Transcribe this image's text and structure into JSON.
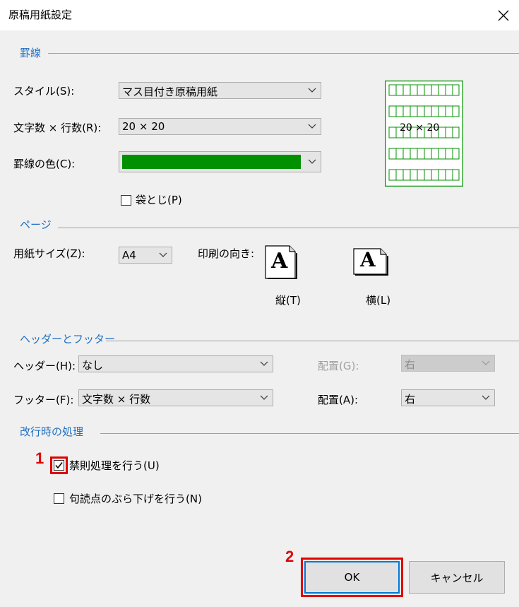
{
  "window": {
    "title": "原稿用紙設定"
  },
  "groups": {
    "keisen": "罫線",
    "page": "ページ",
    "header_footer": "ヘッダーとフッター",
    "linebreak": "改行時の処理"
  },
  "keisen": {
    "style_label": "スタイル(S):",
    "style_value": "マス目付き原稿用紙",
    "count_label": "文字数 × 行数(R):",
    "count_value": "20 × 20",
    "color_label": "罫線の色(C):",
    "color_value": "#009000",
    "fukuro_label": "袋とじ(P)",
    "fukuro_checked": false,
    "preview_text": "20 × 20"
  },
  "page": {
    "size_label": "用紙サイズ(Z):",
    "size_value": "A4",
    "orientation_label": "印刷の向き:",
    "portrait_label": "縦(T)",
    "landscape_label": "横(L)",
    "icon_letter": "A"
  },
  "header_footer": {
    "header_label": "ヘッダー(H):",
    "header_value": "なし",
    "header_align_label": "配置(G):",
    "header_align_value": "右",
    "footer_label": "フッター(F):",
    "footer_value": "文字数 × 行数",
    "footer_align_label": "配置(A):",
    "footer_align_value": "右"
  },
  "linebreak": {
    "kinsoku_label": "禁則処理を行う(U)",
    "kinsoku_checked": true,
    "kutoten_label": "句読点のぶら下げを行う(N)",
    "kutoten_checked": false
  },
  "buttons": {
    "ok": "OK",
    "cancel": "キャンセル"
  },
  "annotations": {
    "step1": "1",
    "step2": "2"
  },
  "colors": {
    "accent": "#1f6fc0",
    "annotation": "#e00000",
    "grid": "#009000"
  }
}
